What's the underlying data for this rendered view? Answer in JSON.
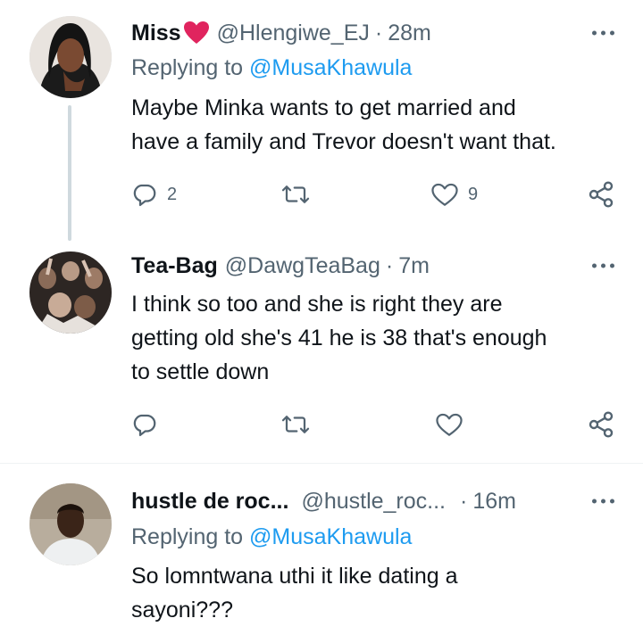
{
  "tweets": [
    {
      "name": "Miss",
      "handle": "@Hlengiwe_EJ",
      "separator": "·",
      "time": "28m",
      "replying_prefix": "Replying to ",
      "replying_to": "@MusaKhawula",
      "text_lines": [
        "Maybe Minka wants to get married and",
        "have a family and Trevor doesn't want that."
      ],
      "replies": "2",
      "retweets": "",
      "likes": "9"
    },
    {
      "name": "Tea-Bag",
      "handle": "@DawgTeaBag",
      "separator": "·",
      "time": "7m",
      "text_lines": [
        "I think so too and she is right they are",
        "getting old she's 41 he is 38 that's enough",
        "to settle down"
      ]
    },
    {
      "name": "hustle de roc...",
      "handle": "@hustle_roc...",
      "separator": "·",
      "time": "16m",
      "replying_prefix": "Replying to ",
      "replying_to": "@MusaKhawula",
      "text_lines": [
        "So lomntwana uthi it like dating a",
        "sayoni???"
      ]
    }
  ],
  "colors": {
    "text": "#0f1419",
    "secondary": "#536471",
    "link": "#1d9bf0",
    "heart_badge": "#e0245e",
    "thread_line": "#cfd9de"
  },
  "icons": [
    "reply-icon",
    "retweet-icon",
    "like-icon",
    "share-icon",
    "more-icon",
    "heart-emoji-icon"
  ]
}
